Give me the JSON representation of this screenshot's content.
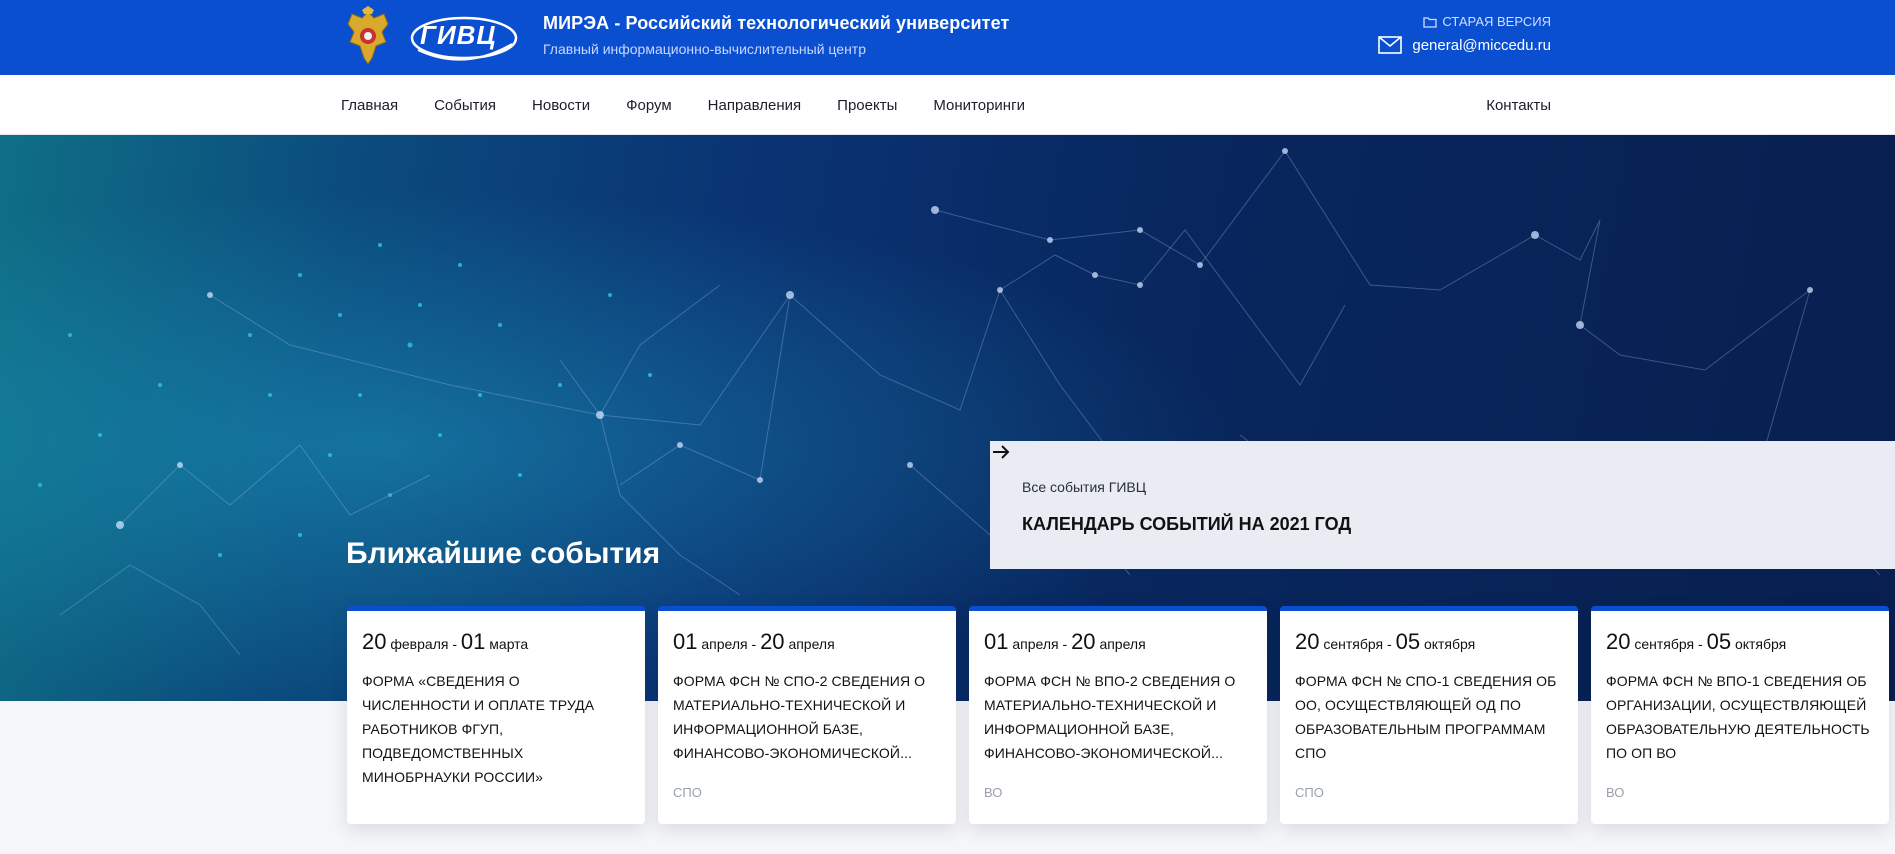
{
  "header": {
    "title": "МИРЭА - Российский технологический университет",
    "subtitle": "Главный информационно-вычислительный центр",
    "old_version": "СТАРАЯ ВЕРСИЯ",
    "email": "general@miccedu.ru",
    "logo_text": "ГИВЦ"
  },
  "nav": {
    "items": [
      "Главная",
      "События",
      "Новости",
      "Форум",
      "Направления",
      "Проекты",
      "Мониторинги"
    ],
    "contacts": "Контакты"
  },
  "hero": {
    "heading": "Ближайшие события",
    "calendar_small": "Все события ГИВЦ",
    "calendar_title": "КАЛЕНДАРЬ СОБЫТИЙ НА 2021 ГОД"
  },
  "events": [
    {
      "start_day": "20",
      "start_month": "февраля",
      "end_day": "01",
      "end_month": "марта",
      "title": "ФОРМА «СВЕДЕНИЯ О ЧИСЛЕННОСТИ И ОПЛАТЕ ТРУДА РАБОТНИКОВ ФГУП, ПОДВЕДОМСТВЕННЫХ МИНОБРНАУКИ РОССИИ»",
      "tag": ""
    },
    {
      "start_day": "01",
      "start_month": "апреля",
      "end_day": "20",
      "end_month": "апреля",
      "title": "ФОРМА ФСН № СПО-2 СВЕДЕНИЯ О МАТЕРИАЛЬНО-ТЕХНИЧЕСКОЙ И ИНФОРМАЦИОННОЙ БАЗЕ, ФИНАНСОВО-ЭКОНОМИЧЕСКОЙ...",
      "tag": "СПО"
    },
    {
      "start_day": "01",
      "start_month": "апреля",
      "end_day": "20",
      "end_month": "апреля",
      "title": "ФОРМА ФСН № ВПО-2 СВЕДЕНИЯ О МАТЕРИАЛЬНО-ТЕХНИЧЕСКОЙ И ИНФОРМАЦИОННОЙ БАЗЕ, ФИНАНСОВО-ЭКОНОМИЧЕСКОЙ...",
      "tag": "ВО"
    },
    {
      "start_day": "20",
      "start_month": "сентября",
      "end_day": "05",
      "end_month": "октября",
      "title": "ФОРМА ФСН № СПО-1 СВЕДЕНИЯ ОБ ОО, ОСУЩЕСТВЛЯЮЩЕЙ ОД ПО ОБРАЗОВАТЕЛЬНЫМ ПРОГРАММАМ СПО",
      "tag": "СПО"
    },
    {
      "start_day": "20",
      "start_month": "сентября",
      "end_day": "05",
      "end_month": "октября",
      "title": "ФОРМА ФСН № ВПО-1 СВЕДЕНИЯ ОБ ОРГАНИЗАЦИИ, ОСУЩЕСТВЛЯЮЩЕЙ ОБРАЗОВАТЕЛЬНУЮ ДЕЯТЕЛЬНОСТЬ ПО ОП ВО",
      "tag": "ВО"
    }
  ],
  "colors": {
    "brand_blue": "#0b4fd1",
    "hero_dark": "#081f4f",
    "card_gray": "#e9ecf2"
  },
  "icons": {
    "crest": "coat-of-arms-icon",
    "folder": "folder-icon",
    "mail": "mail-icon",
    "arrow": "arrow-right-icon"
  }
}
